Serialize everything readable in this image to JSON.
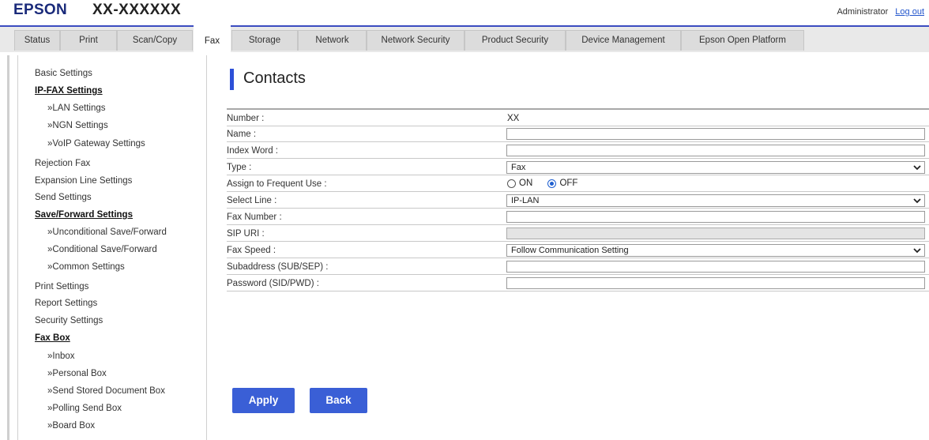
{
  "header": {
    "brand": "EPSON",
    "model": "XX-XXXXXX",
    "user": "Administrator",
    "logout": "Log out"
  },
  "tabs": [
    {
      "label": "Status"
    },
    {
      "label": "Print"
    },
    {
      "label": "Scan/Copy"
    },
    {
      "label": "Fax",
      "active": true
    },
    {
      "label": "Storage"
    },
    {
      "label": "Network"
    },
    {
      "label": "Network Security"
    },
    {
      "label": "Product Security"
    },
    {
      "label": "Device Management"
    },
    {
      "label": "Epson Open Platform"
    }
  ],
  "sidebar": {
    "items": [
      {
        "label": "Basic Settings"
      },
      {
        "label": "IP-FAX Settings"
      },
      {
        "label": "»LAN Settings"
      },
      {
        "label": "»NGN Settings"
      },
      {
        "label": "»VoIP Gateway Settings"
      },
      {
        "label": "Rejection Fax"
      },
      {
        "label": "Expansion Line Settings"
      },
      {
        "label": "Send Settings"
      },
      {
        "label": "Save/Forward Settings"
      },
      {
        "label": "»Unconditional Save/Forward"
      },
      {
        "label": "»Conditional Save/Forward"
      },
      {
        "label": "»Common Settings"
      },
      {
        "label": "Print Settings"
      },
      {
        "label": "Report Settings"
      },
      {
        "label": "Security Settings"
      },
      {
        "label": "Fax Box"
      },
      {
        "label": "»Inbox"
      },
      {
        "label": "»Personal Box"
      },
      {
        "label": "»Send Stored Document Box"
      },
      {
        "label": "»Polling Send Box"
      },
      {
        "label": "»Board Box"
      }
    ]
  },
  "main": {
    "title": "Contacts",
    "fields": {
      "number": {
        "label": "Number :",
        "value": "XX"
      },
      "name": {
        "label": "Name :",
        "value": ""
      },
      "index_word": {
        "label": "Index Word :",
        "value": ""
      },
      "type": {
        "label": "Type :",
        "value": "Fax"
      },
      "frequent": {
        "label": "Assign to Frequent Use :",
        "on": "ON",
        "off": "OFF",
        "selected": "OFF"
      },
      "select_line": {
        "label": "Select Line :",
        "value": "IP-LAN"
      },
      "fax_number": {
        "label": "Fax Number :",
        "value": ""
      },
      "sip_uri": {
        "label": "SIP URI :",
        "value": ""
      },
      "fax_speed": {
        "label": "Fax Speed :",
        "value": "Follow Communication Setting"
      },
      "subaddress": {
        "label": "Subaddress (SUB/SEP) :",
        "value": ""
      },
      "password": {
        "label": "Password (SID/PWD) :",
        "value": ""
      }
    },
    "buttons": {
      "apply": "Apply",
      "back": "Back"
    }
  },
  "colors": {
    "brand": "#1a2a7a",
    "accent": "#3a5fd6",
    "tab_border": "#3b4cc0"
  }
}
